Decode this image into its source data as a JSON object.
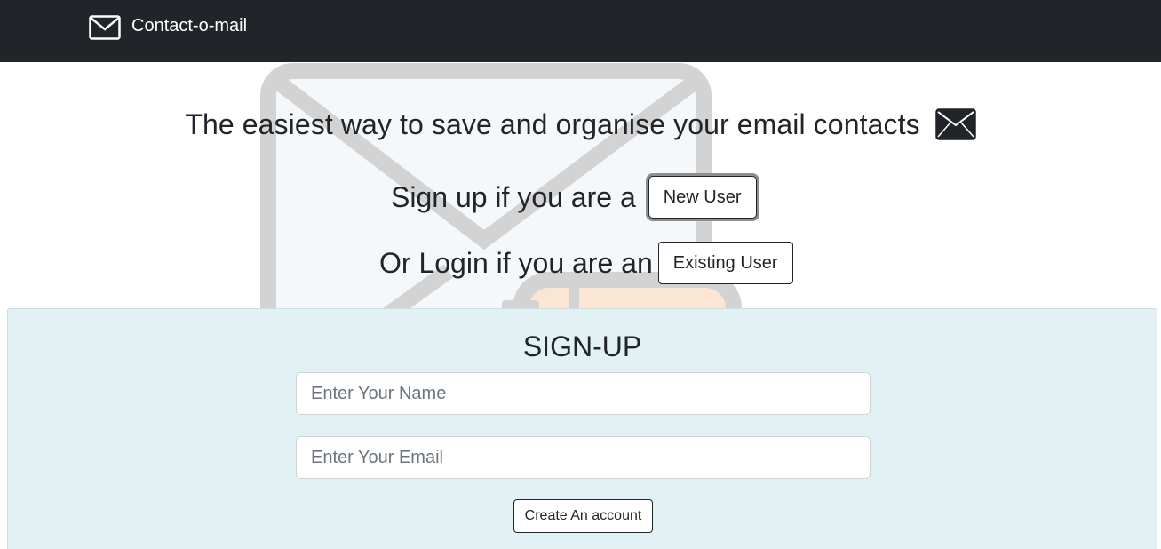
{
  "navbar": {
    "brand_icon": "envelope-icon",
    "brand_label": "Contact-o-mail"
  },
  "hero": {
    "background_image": "envelope-illustration",
    "tagline": "The easiest way to save and organise your email contacts",
    "tagline_icon": "envelope-icon",
    "signup_prompt": "Sign up if you are a",
    "new_user_button": "New User",
    "login_prompt": "Or Login if you are an",
    "existing_user_button": "Existing User"
  },
  "signup": {
    "title": "SIGN-UP",
    "name_placeholder": "Enter Your Name",
    "name_value": "",
    "email_placeholder": "Enter Your Email",
    "email_value": "",
    "create_button": "Create An account"
  },
  "colors": {
    "navbar_bg": "#212529",
    "card_bg": "#e2f1f3",
    "text": "#212529",
    "placeholder": "#6c757d"
  }
}
